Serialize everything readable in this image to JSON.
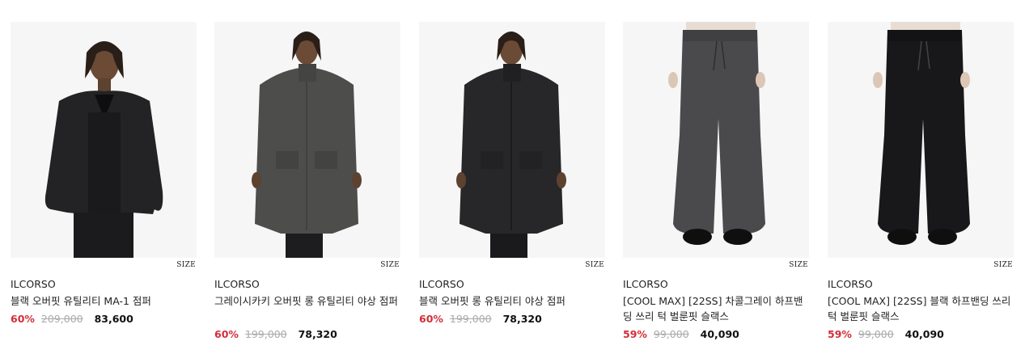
{
  "products": [
    {
      "brand": "ILCORSO",
      "name": "블랙 오버핏 유틸리티 MA-1 점퍼",
      "discount": "60%",
      "original_price": "209,000",
      "price": "83,600",
      "size_label": "SIZE",
      "image_icon": "jacket-product-image"
    },
    {
      "brand": "ILCORSO",
      "name": "그레이시카키 오버핏 롱 유틸리티 야상 점퍼",
      "discount": "60%",
      "original_price": "199,000",
      "price": "78,320",
      "size_label": "SIZE",
      "image_icon": "coat-product-image"
    },
    {
      "brand": "ILCORSO",
      "name": "블랙 오버핏 롱 유틸리티 야상 점퍼",
      "discount": "60%",
      "original_price": "199,000",
      "price": "78,320",
      "size_label": "SIZE",
      "image_icon": "coat-product-image"
    },
    {
      "brand": "ILCORSO",
      "name": "[COOL MAX] [22SS] 차콜그레이 하프밴딩 쓰리 턱 벌룬핏 슬랙스",
      "discount": "59%",
      "original_price": "99,000",
      "price": "40,090",
      "size_label": "SIZE",
      "image_icon": "pants-product-image"
    },
    {
      "brand": "ILCORSO",
      "name": "[COOL MAX] [22SS] 블랙 하프밴딩 쓰리 턱 벌룬핏 슬랙스",
      "discount": "59%",
      "original_price": "99,000",
      "price": "40,090",
      "size_label": "SIZE",
      "image_icon": "pants-product-image"
    }
  ],
  "colors": {
    "discount": "#d22e3a",
    "original_price": "#aaaaaa",
    "image_bg": "#f6f6f6"
  }
}
